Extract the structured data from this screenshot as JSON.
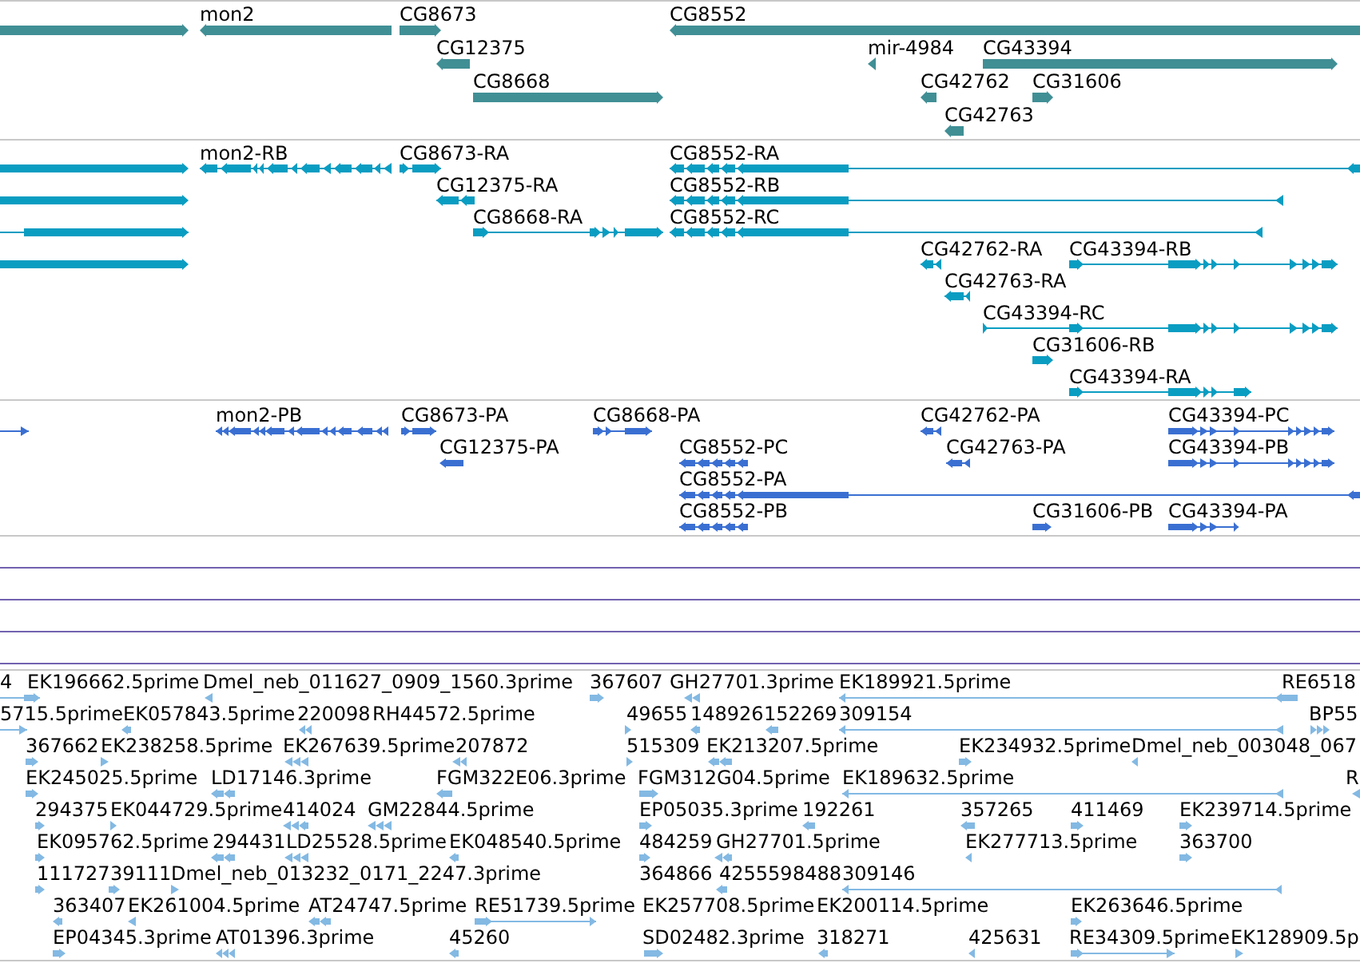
{
  "tracks": [
    {
      "kind": "gene",
      "color": "#408f95",
      "features": [
        {
          "reverse": false
        },
        {
          "label": "mon2",
          "reverse": true
        },
        {
          "label": "CG8673",
          "reverse": false
        },
        {
          "label": "CG8552",
          "reverse": true
        },
        {
          "label": "CG12375",
          "reverse": true
        },
        {
          "label": "mir-4984",
          "reverse": true
        },
        {
          "label": "CG43394",
          "reverse": false
        },
        {
          "label": "CG8668",
          "reverse": false
        },
        {
          "label": "CG42762",
          "reverse": true
        },
        {
          "label": "CG31606",
          "reverse": false
        },
        {
          "label": "CG42763",
          "reverse": true
        }
      ]
    },
    {
      "kind": "transcript",
      "color": "#0a9dc2",
      "features": [
        {
          "reverse": false
        },
        {
          "reverse": false
        },
        {
          "reverse": false
        },
        {
          "reverse": false
        },
        {
          "label": "mon2-RB",
          "reverse": true
        },
        {
          "label": "CG8673-RA",
          "reverse": false
        },
        {
          "label": "CG8552-RA",
          "reverse": true
        },
        {
          "label": "CG12375-RA",
          "reverse": true
        },
        {
          "label": "CG8552-RB",
          "reverse": true
        },
        {
          "label": "CG8668-RA",
          "reverse": false
        },
        {
          "label": "CG8552-RC",
          "reverse": true
        },
        {
          "label": "CG42762-RA",
          "reverse": true
        },
        {
          "label": "CG43394-RB",
          "reverse": false
        },
        {
          "label": "CG42763-RA",
          "reverse": true
        },
        {
          "label": "CG43394-RC",
          "reverse": false
        },
        {
          "label": "CG31606-RB",
          "reverse": false
        },
        {
          "label": "CG43394-RA",
          "reverse": false
        }
      ]
    },
    {
      "kind": "protein",
      "color": "#3a6fd2",
      "features": [
        {
          "reverse": false
        },
        {
          "label": "mon2-PB",
          "reverse": true
        },
        {
          "label": "CG8673-PA",
          "reverse": false
        },
        {
          "label": "CG8668-PA",
          "reverse": false
        },
        {
          "label": "CG42762-PA",
          "reverse": true
        },
        {
          "label": "CG43394-PC",
          "reverse": false
        },
        {
          "label": "CG12375-PA",
          "reverse": true
        },
        {
          "label": "CG8552-PC",
          "reverse": true
        },
        {
          "label": "CG42763-PA",
          "reverse": true
        },
        {
          "label": "CG43394-PB",
          "reverse": false
        },
        {
          "label": "CG8552-PA",
          "reverse": true
        },
        {
          "label": "CG8552-PB",
          "reverse": true
        },
        {
          "label": "CG31606-PB",
          "reverse": false
        },
        {
          "label": "CG43394-PA",
          "reverse": false
        }
      ]
    },
    {
      "kind": "empty",
      "color": "#7262b0"
    },
    {
      "kind": "empty",
      "color": "#7262b0"
    },
    {
      "kind": "empty",
      "color": "#7262b0"
    },
    {
      "kind": "empty",
      "color": "#7262b0"
    },
    {
      "kind": "read",
      "color": "#83b9e3",
      "features": [
        {
          "label": "4",
          "reverse": false
        },
        {
          "label": "EK196662.5prime"
        },
        {
          "label": "Dmel_neb_011627_0909_1560.3prime",
          "reverse": true
        },
        {
          "label": "367607",
          "reverse": false
        },
        {
          "label": "GH27701.3prime",
          "reverse": true
        },
        {
          "label": "EK189921.5prime",
          "reverse": true
        },
        {
          "label": "RE6518"
        },
        {
          "label": "5715.5prime",
          "reverse": false
        },
        {
          "label": "EK057843.5prime",
          "reverse": true
        },
        {
          "label": "220098",
          "reverse": true
        },
        {
          "label": "RH44572.5prime"
        },
        {
          "label": "49655",
          "reverse": false
        },
        {
          "label": "148926",
          "reverse": true
        },
        {
          "label": "152269",
          "reverse": true
        },
        {
          "label": "309154",
          "reverse": true
        },
        {
          "label": "BP55",
          "reverse": false
        },
        {
          "label": "367662",
          "reverse": false
        },
        {
          "label": "EK238258.5prime",
          "reverse": false
        },
        {
          "label": "EK267639.5prime",
          "reverse": true
        },
        {
          "label": "207872",
          "reverse": true
        },
        {
          "label": "515309",
          "reverse": false
        },
        {
          "label": "EK213207.5prime",
          "reverse": true
        },
        {
          "label": "EK234932.5prime",
          "reverse": false
        },
        {
          "label": "Dmel_neb_003048_067",
          "reverse": true
        },
        {
          "label": "EK245025.5prime",
          "reverse": false
        },
        {
          "label": "LD17146.3prime",
          "reverse": true
        },
        {
          "label": "FGM322E06.3prime",
          "reverse": true
        },
        {
          "label": "FGM312G04.5prime",
          "reverse": false
        },
        {
          "label": "EK189632.5prime",
          "reverse": true
        },
        {
          "label": "R",
          "reverse": true
        },
        {
          "label": "294375",
          "reverse": false
        },
        {
          "label": "EK044729.5prime",
          "reverse": false
        },
        {
          "label": "414024",
          "reverse": true
        },
        {
          "label": "GM22844.5prime",
          "reverse": true
        },
        {
          "label": "EP05035.3prime",
          "reverse": false
        },
        {
          "label": "192261",
          "reverse": true
        },
        {
          "label": "357265",
          "reverse": true
        },
        {
          "label": "411469",
          "reverse": false
        },
        {
          "label": "EK239714.5prime",
          "reverse": false
        },
        {
          "label": "EK095762.5prime",
          "reverse": false
        },
        {
          "label": "294431",
          "reverse": true
        },
        {
          "label": "LD25528.5prime",
          "reverse": true
        },
        {
          "label": "EK048540.5prime",
          "reverse": true
        },
        {
          "label": "484259",
          "reverse": false
        },
        {
          "label": "GH27701.5prime",
          "reverse": true
        },
        {
          "label": "EK277713.5prime",
          "reverse": true
        },
        {
          "label": "363700",
          "reverse": false
        },
        {
          "label": "111727",
          "reverse": false
        },
        {
          "label": "39111",
          "reverse": false
        },
        {
          "label": "Dmel_neb_013232_0171_2247.3prime",
          "reverse": false
        },
        {
          "label": "364866"
        },
        {
          "label": "425559",
          "reverse": true
        },
        {
          "label": "8488"
        },
        {
          "label": "309146",
          "reverse": true
        },
        {
          "label": "363407",
          "reverse": true
        },
        {
          "label": "EK261004.5prime",
          "reverse": true
        },
        {
          "label": "AT24747.5prime",
          "reverse": true
        },
        {
          "label": "RE51739.5prime",
          "reverse": false
        },
        {
          "label": "EK257708.5prime"
        },
        {
          "label": "EK200114.5prime"
        },
        {
          "label": "EK263646.5prime",
          "reverse": false
        },
        {
          "label": "EP04345.3prime",
          "reverse": false
        },
        {
          "label": "AT01396.3prime",
          "reverse": true
        },
        {
          "label": "45260",
          "reverse": true
        },
        {
          "label": "SD02482.3prime",
          "reverse": false
        },
        {
          "label": "318271",
          "reverse": true
        },
        {
          "label": "425631",
          "reverse": true
        },
        {
          "label": "RE34309.5prime",
          "reverse": false
        },
        {
          "label": "EK128909.5p",
          "reverse": false
        }
      ]
    }
  ]
}
